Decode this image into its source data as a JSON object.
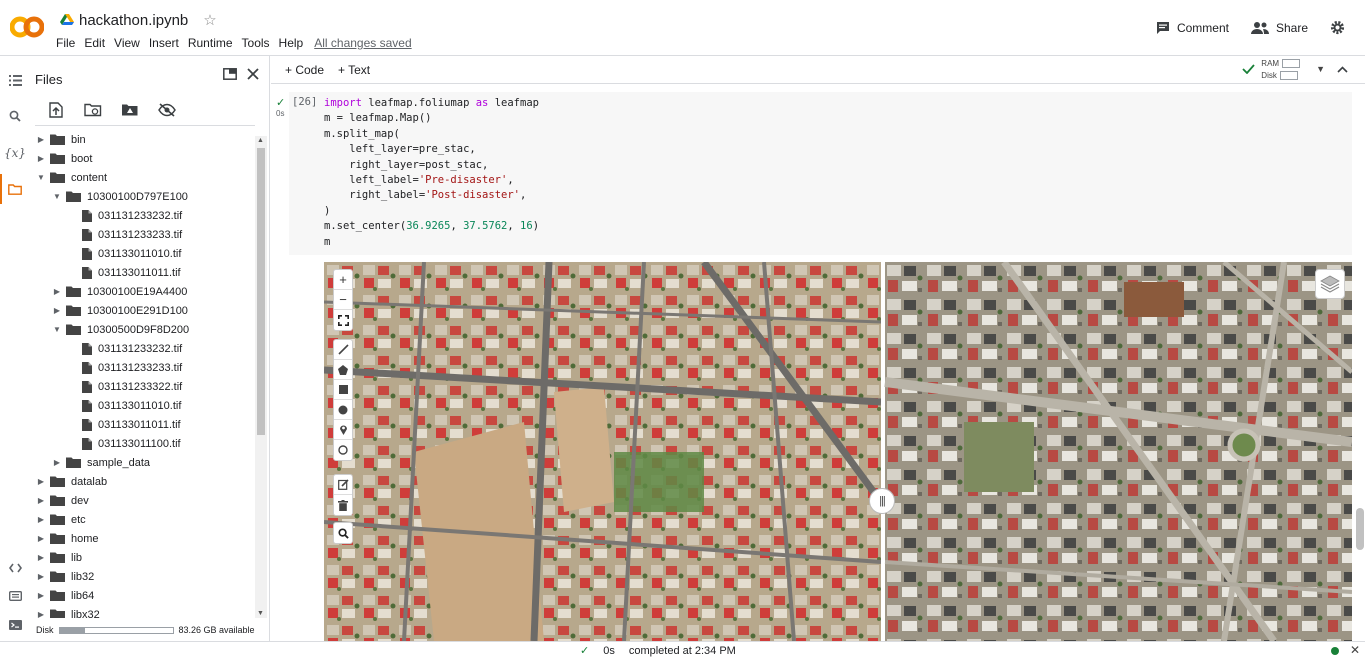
{
  "app": {
    "logo_text": "CO",
    "notebook_name": "hackathon.ipynb",
    "menu": [
      "File",
      "Edit",
      "View",
      "Insert",
      "Runtime",
      "Tools",
      "Help"
    ],
    "save_status": "All changes saved",
    "comment_label": "Comment",
    "share_label": "Share"
  },
  "files_panel": {
    "title": "Files",
    "tree": [
      {
        "label": "bin",
        "type": "folder",
        "depth": 0,
        "expanded": false
      },
      {
        "label": "boot",
        "type": "folder",
        "depth": 0,
        "expanded": false
      },
      {
        "label": "content",
        "type": "folder",
        "depth": 0,
        "expanded": true
      },
      {
        "label": "10300100D797E100",
        "type": "folder",
        "depth": 1,
        "expanded": true
      },
      {
        "label": "031131233232.tif",
        "type": "file",
        "depth": 2
      },
      {
        "label": "031131233233.tif",
        "type": "file",
        "depth": 2
      },
      {
        "label": "031133011010.tif",
        "type": "file",
        "depth": 2
      },
      {
        "label": "031133011011.tif",
        "type": "file",
        "depth": 2
      },
      {
        "label": "10300100E19A4400",
        "type": "folder",
        "depth": 1,
        "expanded": false
      },
      {
        "label": "10300100E291D100",
        "type": "folder",
        "depth": 1,
        "expanded": false
      },
      {
        "label": "10300500D9F8D200",
        "type": "folder",
        "depth": 1,
        "expanded": true
      },
      {
        "label": "031131233232.tif",
        "type": "file",
        "depth": 2
      },
      {
        "label": "031131233233.tif",
        "type": "file",
        "depth": 2
      },
      {
        "label": "031131233322.tif",
        "type": "file",
        "depth": 2
      },
      {
        "label": "031133011010.tif",
        "type": "file",
        "depth": 2
      },
      {
        "label": "031133011011.tif",
        "type": "file",
        "depth": 2
      },
      {
        "label": "031133011100.tif",
        "type": "file",
        "depth": 2
      },
      {
        "label": "sample_data",
        "type": "folder",
        "depth": 1,
        "expanded": false
      },
      {
        "label": "datalab",
        "type": "folder",
        "depth": 0,
        "expanded": false
      },
      {
        "label": "dev",
        "type": "folder",
        "depth": 0,
        "expanded": false
      },
      {
        "label": "etc",
        "type": "folder",
        "depth": 0,
        "expanded": false
      },
      {
        "label": "home",
        "type": "folder",
        "depth": 0,
        "expanded": false
      },
      {
        "label": "lib",
        "type": "folder",
        "depth": 0,
        "expanded": false
      },
      {
        "label": "lib32",
        "type": "folder",
        "depth": 0,
        "expanded": false
      },
      {
        "label": "lib64",
        "type": "folder",
        "depth": 0,
        "expanded": false
      },
      {
        "label": "libx32",
        "type": "folder",
        "depth": 0,
        "expanded": false
      }
    ],
    "disk_label": "Disk",
    "disk_available": "83.26 GB available",
    "disk_used_fraction": 0.23
  },
  "notebook": {
    "add_code": "Code",
    "add_text": "Text",
    "ram_label": "RAM",
    "disk_label": "Disk",
    "cell": {
      "number": "[26]",
      "exec_time": "0s"
    }
  },
  "status_bar": {
    "duration": "0s",
    "message": "completed at 2:34 PM"
  },
  "colors": {
    "logo_orange": "#e8710a",
    "logo_yellow": "#f9ab00",
    "check_green": "#188038",
    "keyword": "#af00db",
    "string": "#a31515",
    "number": "#098658"
  }
}
